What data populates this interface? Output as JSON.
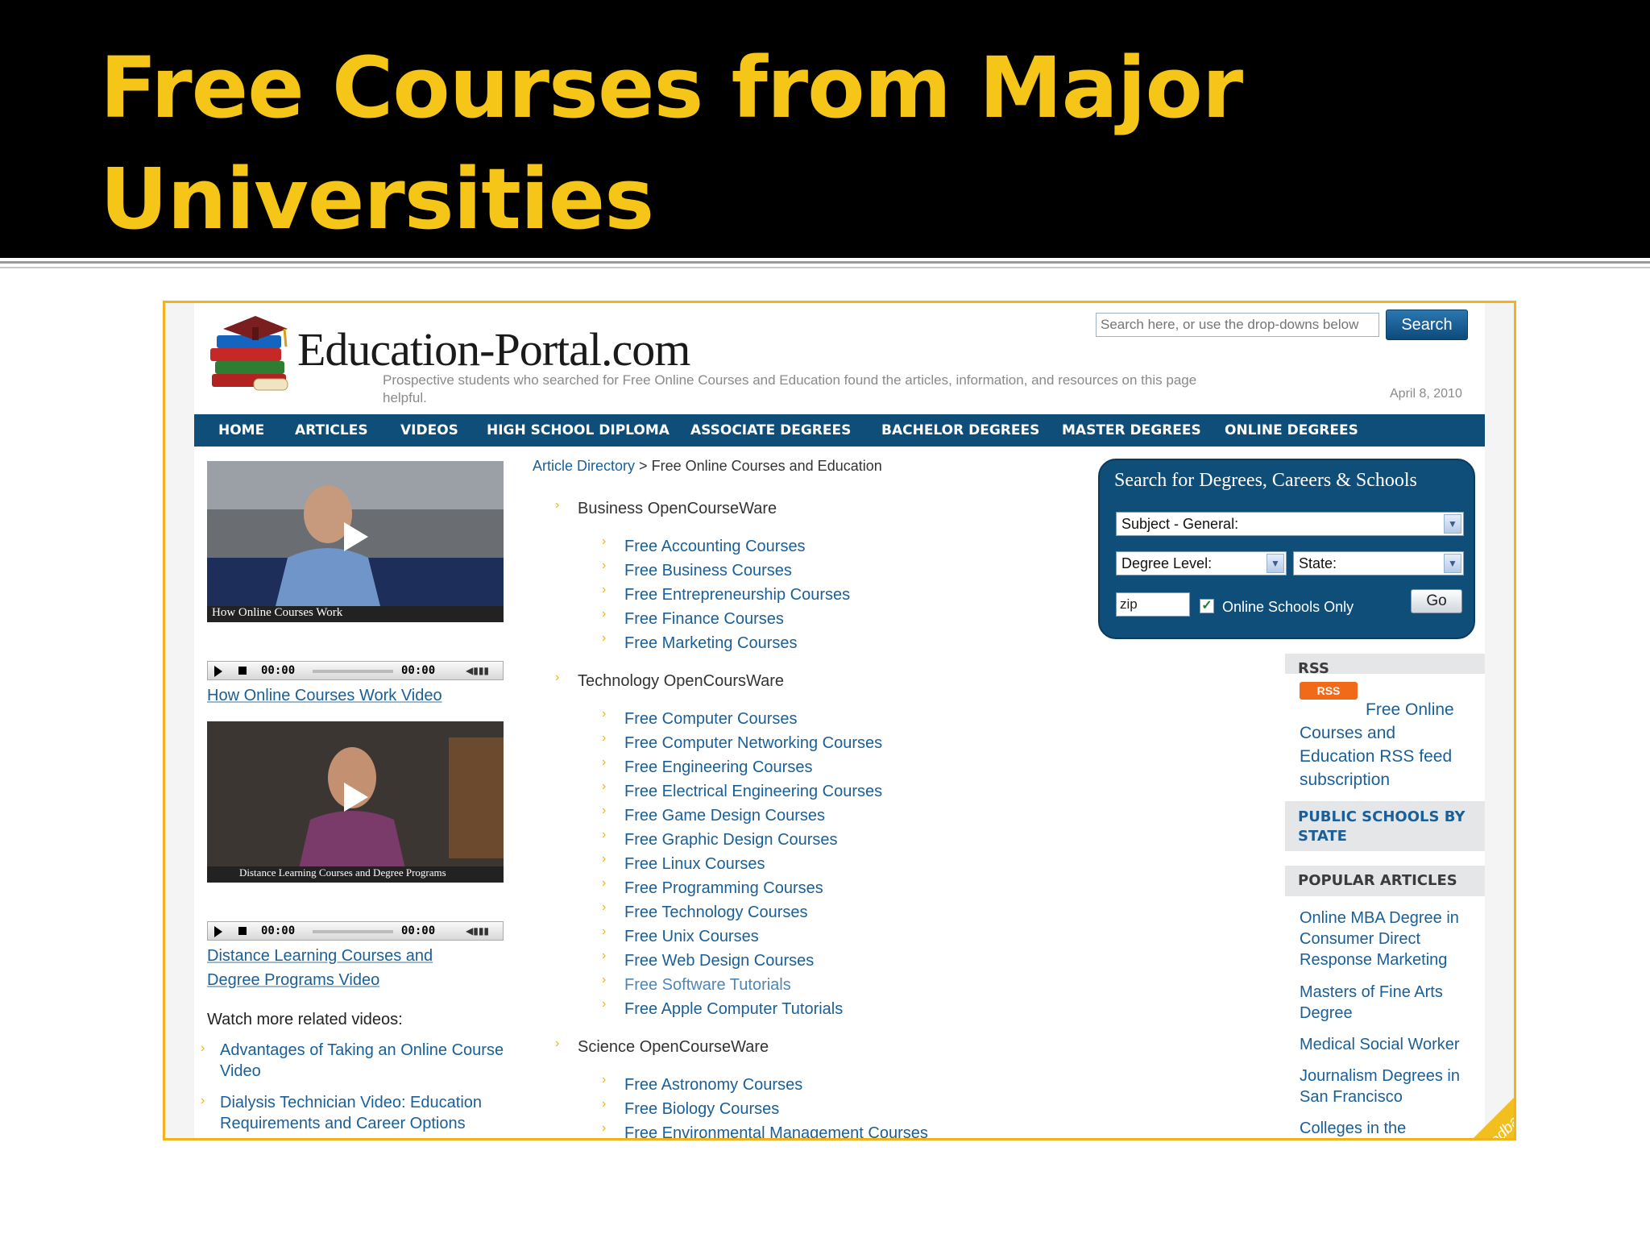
{
  "slide": {
    "title_line1": "Free Courses from Major",
    "title_line2": "Universities"
  },
  "site": {
    "name": "Education-Portal.com",
    "tagline": "Prospective students who searched for Free Online Courses and Education found the articles, information, and resources on this page helpful.",
    "date": "April 8, 2010",
    "search_placeholder": "Search here, or use the drop-downs below",
    "search_button": "Search"
  },
  "nav": [
    "HOME",
    "ARTICLES",
    "VIDEOS",
    "HIGH SCHOOL DIPLOMA",
    "ASSOCIATE DEGREES",
    "BACHELOR DEGREES",
    "MASTER DEGREES",
    "ONLINE DEGREES"
  ],
  "videos": [
    {
      "overlay": "How Online Courses Work",
      "time_a": "00:00",
      "time_b": "00:00",
      "link": "How Online Courses Work Video"
    },
    {
      "overlay": "Distance Learning Courses and Degree Programs",
      "time_a": "00:00",
      "time_b": "00:00",
      "link_line1": "Distance Learning Courses and",
      "link_line2": "Degree Programs Video"
    }
  ],
  "watch_more": "Watch more related videos:",
  "related_videos": [
    "Advantages of Taking an Online Course Video",
    "Dialysis Technician Video: Education Requirements and Career Options"
  ],
  "breadcrumb": {
    "link": "Article Directory",
    "sep": ">",
    "current": "Free Online Courses and Education"
  },
  "sections": [
    {
      "title": "Business OpenCourseWare",
      "items": [
        "Free Accounting Courses",
        "Free Business Courses",
        "Free Entrepreneurship Courses",
        "Free Finance Courses",
        "Free Marketing Courses"
      ]
    },
    {
      "title": "Technology OpenCoursWare",
      "items": [
        "Free Computer Courses",
        "Free Computer Networking Courses",
        "Free Engineering Courses",
        "Free Electrical Engineering Courses",
        "Free Game Design Courses",
        "Free Graphic Design Courses",
        "Free Linux Courses",
        "Free Programming Courses",
        "Free Technology Courses",
        "Free Unix Courses",
        "Free Web Design Courses",
        "Free Software Tutorials",
        "Free Apple Computer Tutorials"
      ]
    },
    {
      "title": "Science OpenCourseWare",
      "items": [
        "Free Astronomy Courses",
        "Free Biology Courses",
        "Free Environmental Management Courses"
      ]
    }
  ],
  "degree_search": {
    "title": "Search for Degrees, Careers & Schools",
    "subject": "Subject - General:",
    "degree_level": "Degree Level:",
    "state": "State:",
    "zip": "zip",
    "online_only": "Online Schools Only",
    "go": "Go"
  },
  "sidebar": {
    "rss_head": "RSS",
    "rss_badge": "RSS",
    "rss_text": "Free Online Courses and Education RSS feed subscription",
    "public_schools": "PUBLIC SCHOOLS BY STATE",
    "popular_head": "POPULAR ARTICLES",
    "popular": [
      "Online MBA Degree in Consumer Direct Response Marketing",
      "Masters of Fine Arts Degree",
      "Medical Social Worker",
      "Journalism Degrees in San Francisco",
      "Colleges in the"
    ]
  },
  "feedback": "Give Feedback",
  "colors": {
    "title_gold": "#f5c518",
    "nav_blue": "#0f4e78",
    "link_blue": "#1a5f97",
    "frame_gold": "#f2b21a"
  }
}
